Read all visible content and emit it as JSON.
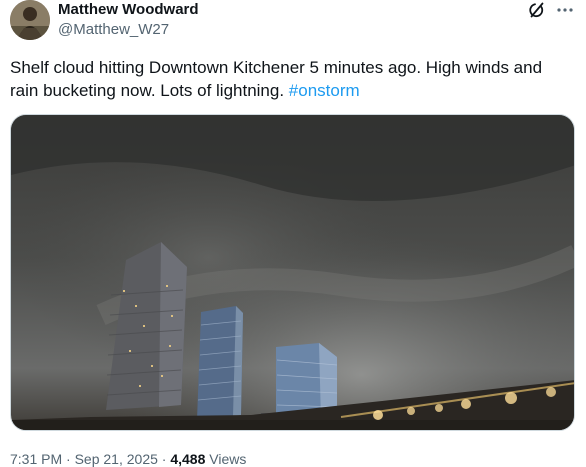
{
  "author": {
    "name": "Matthew Woodward",
    "handle": "@Matthew_W27"
  },
  "tweet": {
    "text": "Shelf cloud hitting Downtown Kitchener 5 minutes ago. High winds and rain bucketing now. Lots of lightning. ",
    "hashtag": "#onstorm"
  },
  "media": {
    "description_icon": "video-thumbnail"
  },
  "meta": {
    "time": "7:31 PM",
    "separator1": " · ",
    "date": "Sep 21, 2025",
    "separator2": " · ",
    "views_count": "4,488",
    "views_label": " Views"
  },
  "icons": {
    "grok": "grok-icon",
    "more": "more-icon"
  },
  "colors": {
    "link": "#1d9bf0",
    "secondary_text": "#536471",
    "primary_text": "#0f1419"
  }
}
